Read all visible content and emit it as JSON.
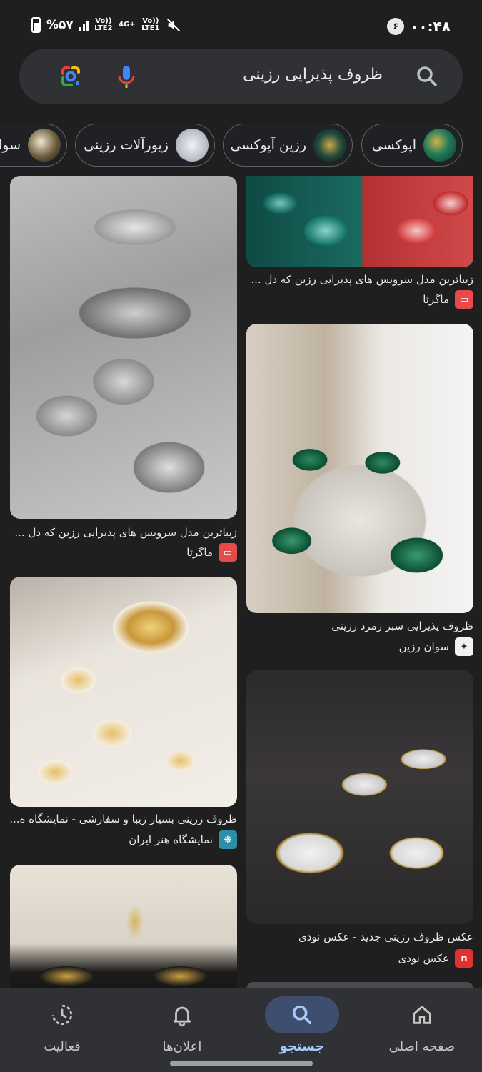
{
  "status_bar": {
    "battery": "%۵۷",
    "sim1_label": "Vo)) LTE2",
    "net_label": "4G+",
    "sim2_label": "Vo)) LTE1",
    "notification_count": "۶",
    "time": "۰۰:۴۸"
  },
  "search": {
    "query": "ظروف پذیرایی رزینی"
  },
  "chips": [
    {
      "label": "اپوکسی"
    },
    {
      "label": "رزین آپوکسی"
    },
    {
      "label": "زیورآلات رزینی"
    },
    {
      "label": "سوار"
    }
  ],
  "results": [
    {
      "title": "زیباترین مدل سرویس های پذیرایی رزین که دل ...",
      "source": "ماگرتا"
    },
    {
      "title": "زیباترین مدل سرویس های پذیرایی رزین که دل ...",
      "source": "ماگرتا"
    },
    {
      "title": "ظروف پذیرایی سبز زمرد رزینی",
      "source": "سوان رزین"
    },
    {
      "title": "ظروف رزینی بسیار زیبا و سفارشی - نمایشگاه ه...",
      "source": "نمایشگاه هنر ایران"
    },
    {
      "title": "عکس ظروف رزینی جدید - عکس نودی",
      "source": "عکس نودی"
    }
  ],
  "bottom_nav": [
    {
      "label": "صفحه اصلی"
    },
    {
      "label": "جستجو"
    },
    {
      "label": "اعلان‌ها"
    },
    {
      "label": "فعالیت"
    }
  ],
  "colors": {
    "background": "#1f1f1f",
    "search_bg": "#303134",
    "active_nav": "#a8c7fa",
    "magerta_icon": "#e64a4a",
    "nodi_icon": "#e0322f"
  }
}
